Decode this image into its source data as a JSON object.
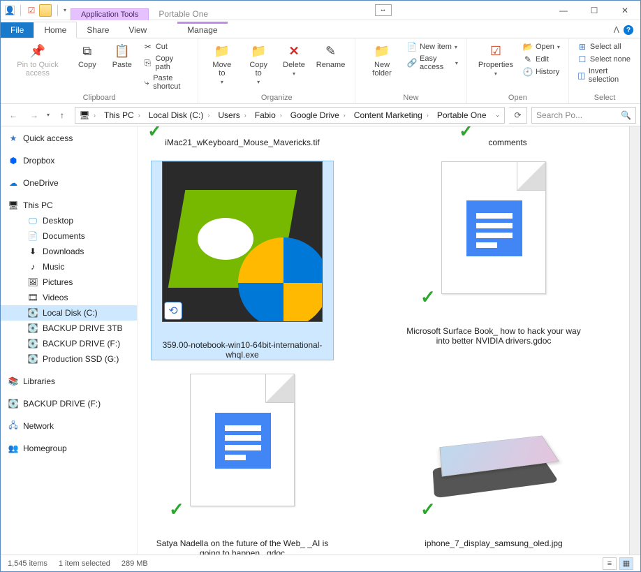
{
  "window": {
    "context_tab": "Application Tools",
    "title": "Portable One"
  },
  "ribbon_tabs": {
    "file": "File",
    "home": "Home",
    "share": "Share",
    "view": "View",
    "manage": "Manage"
  },
  "ribbon": {
    "clipboard": {
      "label": "Clipboard",
      "pin": "Pin to Quick access",
      "copy": "Copy",
      "paste": "Paste",
      "cut": "Cut",
      "copy_path": "Copy path",
      "paste_shortcut": "Paste shortcut"
    },
    "organize": {
      "label": "Organize",
      "move_to": "Move to",
      "copy_to": "Copy to",
      "delete": "Delete",
      "rename": "Rename"
    },
    "new": {
      "label": "New",
      "new_folder": "New folder",
      "new_item": "New item",
      "easy_access": "Easy access"
    },
    "open": {
      "label": "Open",
      "properties": "Properties",
      "open": "Open",
      "edit": "Edit",
      "history": "History"
    },
    "select": {
      "label": "Select",
      "select_all": "Select all",
      "select_none": "Select none",
      "invert": "Invert selection"
    }
  },
  "breadcrumb": [
    "This PC",
    "Local Disk (C:)",
    "Users",
    "Fabio",
    "Google Drive",
    "Content Marketing",
    "Portable One"
  ],
  "search": {
    "placeholder": "Search Po..."
  },
  "navpane": {
    "quick_access": "Quick access",
    "dropbox": "Dropbox",
    "onedrive": "OneDrive",
    "this_pc": "This PC",
    "desktop": "Desktop",
    "documents": "Documents",
    "downloads": "Downloads",
    "music": "Music",
    "pictures": "Pictures",
    "videos": "Videos",
    "local_disk": "Local Disk (C:)",
    "backup3tb": "BACKUP DRIVE 3TB",
    "backupf": "BACKUP DRIVE (F:)",
    "prodssd": "Production SSD (G:)",
    "libraries": "Libraries",
    "backupf2": "BACKUP DRIVE (F:)",
    "network": "Network",
    "homegroup": "Homegroup"
  },
  "files": {
    "f1": "iMac21_wKeyboard_Mouse_Mavericks.tif",
    "f2": "comments",
    "f3": "359.00-notebook-win10-64bit-international-whql.exe",
    "f4": "Microsoft Surface Book_ how to hack your way into better NVIDIA drivers.gdoc",
    "f5": "Satya Nadella on the future of the Web_ _AI is going to happen_.gdoc",
    "f6": "iphone_7_display_samsung_oled.jpg"
  },
  "status": {
    "count": "1,545 items",
    "selection": "1 item selected",
    "size": "289 MB"
  }
}
